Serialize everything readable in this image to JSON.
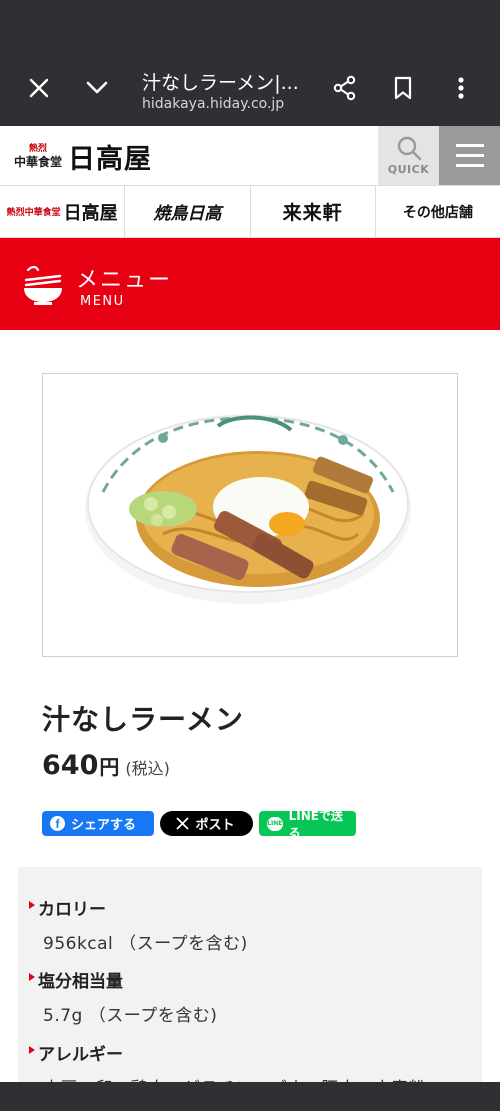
{
  "browser": {
    "title": "汁なしラーメン|...",
    "url": "hidakaya.hiday.co.jp"
  },
  "header": {
    "logo_small_top": "熱烈",
    "logo_small_bottom": "中華食堂",
    "logo_main": "日高屋",
    "quick_label": "QUICK"
  },
  "brands": [
    {
      "label": "日高屋",
      "small": "熱烈中華食堂"
    },
    {
      "label": "焼鳥日高"
    },
    {
      "label": "来来軒"
    },
    {
      "label": "その他店舗"
    }
  ],
  "banner": {
    "title": "メニュー",
    "subtitle": "MENU"
  },
  "product": {
    "name": "汁なしラーメン",
    "price": "640",
    "yen": "円",
    "tax": "(税込)"
  },
  "share": {
    "facebook": "シェアする",
    "x": "ポスト",
    "line_icon": "LINE",
    "line": "LINEで送る"
  },
  "info": [
    {
      "label": "カロリー",
      "value": "956kcal （スープを含む)"
    },
    {
      "label": "塩分相当量",
      "value": "5.7g （スープを含む)"
    },
    {
      "label": "アレルギー",
      "value": "大豆、卵、鶏肉、ゼラチン、ごま、豚肉、小麦粉"
    }
  ],
  "colors": {
    "brand_red": "#e60012",
    "browser_bar": "#2e3033",
    "facebook": "#1877f2",
    "line": "#06c755"
  },
  "icons": [
    "close-icon",
    "chevron-down-icon",
    "share-icon",
    "bookmark-icon",
    "more-vert-icon",
    "search-icon",
    "hamburger-icon",
    "ramen-bowl-icon",
    "facebook-icon",
    "x-logo-icon",
    "line-icon"
  ]
}
